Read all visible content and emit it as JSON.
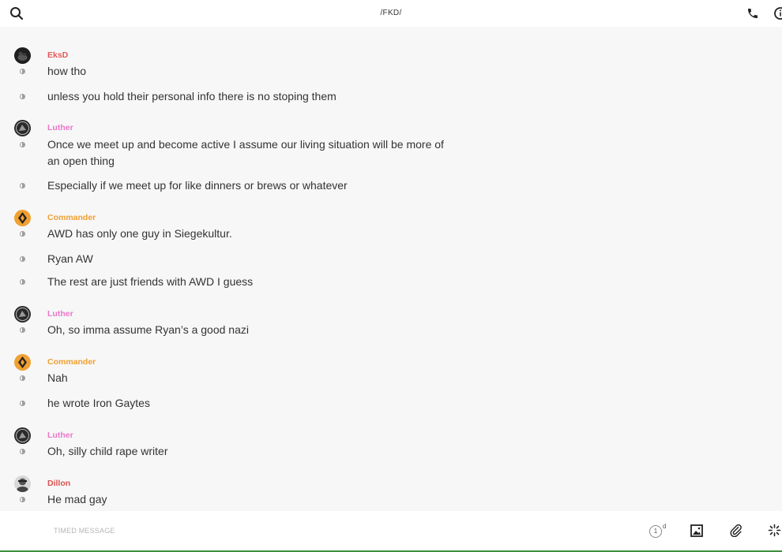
{
  "header": {
    "title": "/FKD/"
  },
  "icons": {
    "search": "search-icon",
    "phone": "phone-icon",
    "info": "info-icon",
    "image": "image-icon",
    "attach": "paperclip-icon",
    "magic": "sparkle-icon"
  },
  "colors": {
    "eksd": "#e05a5a",
    "luther": "#e879c8",
    "commander": "#f0a030",
    "dillon": "#d9534f"
  },
  "messages": [
    {
      "sender": "EksD",
      "lines": [
        "how tho",
        "unless you hold their personal info there is no stoping them"
      ]
    },
    {
      "sender": "Luther",
      "lines": [
        "Once we meet up and become active I assume our living situation will be more of an open thing",
        "Especially if we meet up for like dinners or brews or whatever"
      ]
    },
    {
      "sender": "Commander",
      "lines": [
        "AWD has only one guy in Siegekultur.",
        "Ryan AW",
        "The rest are just friends with AWD I guess"
      ]
    },
    {
      "sender": "Luther",
      "lines": [
        "Oh, so imma assume Ryan’s a good nazi"
      ]
    },
    {
      "sender": "Commander",
      "lines": [
        "Nah",
        "he wrote Iron Gaytes"
      ]
    },
    {
      "sender": "Luther",
      "lines": [
        "Oh, silly child rape writer"
      ]
    },
    {
      "sender": "Dillon",
      "lines": [
        "He mad gay"
      ]
    }
  ],
  "composer": {
    "placeholder": "TIMED MESSAGE",
    "timer_value": "1",
    "timer_unit": "d"
  }
}
